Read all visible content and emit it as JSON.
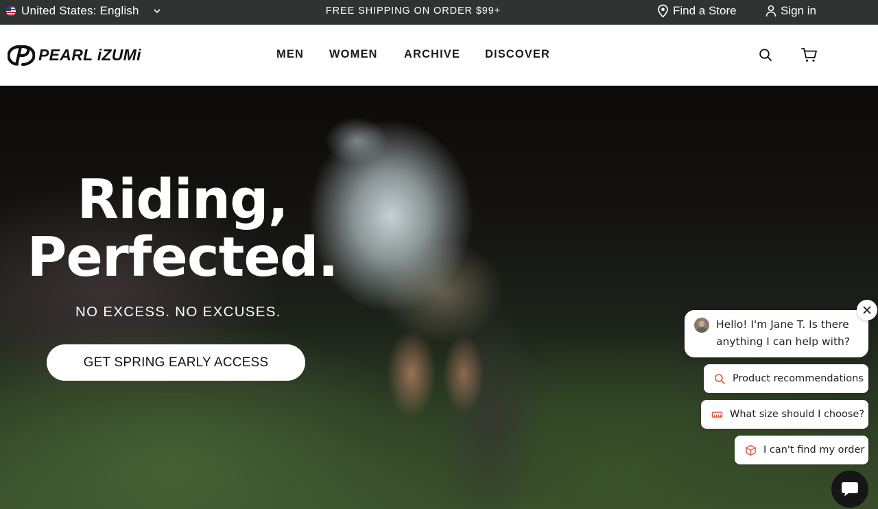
{
  "topbar": {
    "locale_label": "United States: English",
    "promo": "FREE SHIPPING ON ORDER $99+",
    "store_label": "Find a Store",
    "signin_label": "Sign in"
  },
  "header": {
    "logo_text": "PEARL iZUMi",
    "nav": [
      "MEN",
      "WOMEN",
      "ARCHIVE",
      "DISCOVER"
    ]
  },
  "hero": {
    "title_line1": "Riding,",
    "title_line2": "Perfected.",
    "subtitle": "NO EXCESS. NO EXCUSES.",
    "cta_label": "GET SPRING EARLY ACCESS"
  },
  "chat": {
    "greeting": "Hello! I'm Jane T. Is there anything I can help with?",
    "options": [
      {
        "label": "Product recommendations",
        "icon": "search-icon"
      },
      {
        "label": "What size should I choose?",
        "icon": "ruler-icon"
      },
      {
        "label": "I can't find my order",
        "icon": "package-icon"
      }
    ]
  },
  "colors": {
    "topbar_bg": "#2f3432",
    "accent": "#e2533b",
    "chat_launcher": "#161616"
  }
}
